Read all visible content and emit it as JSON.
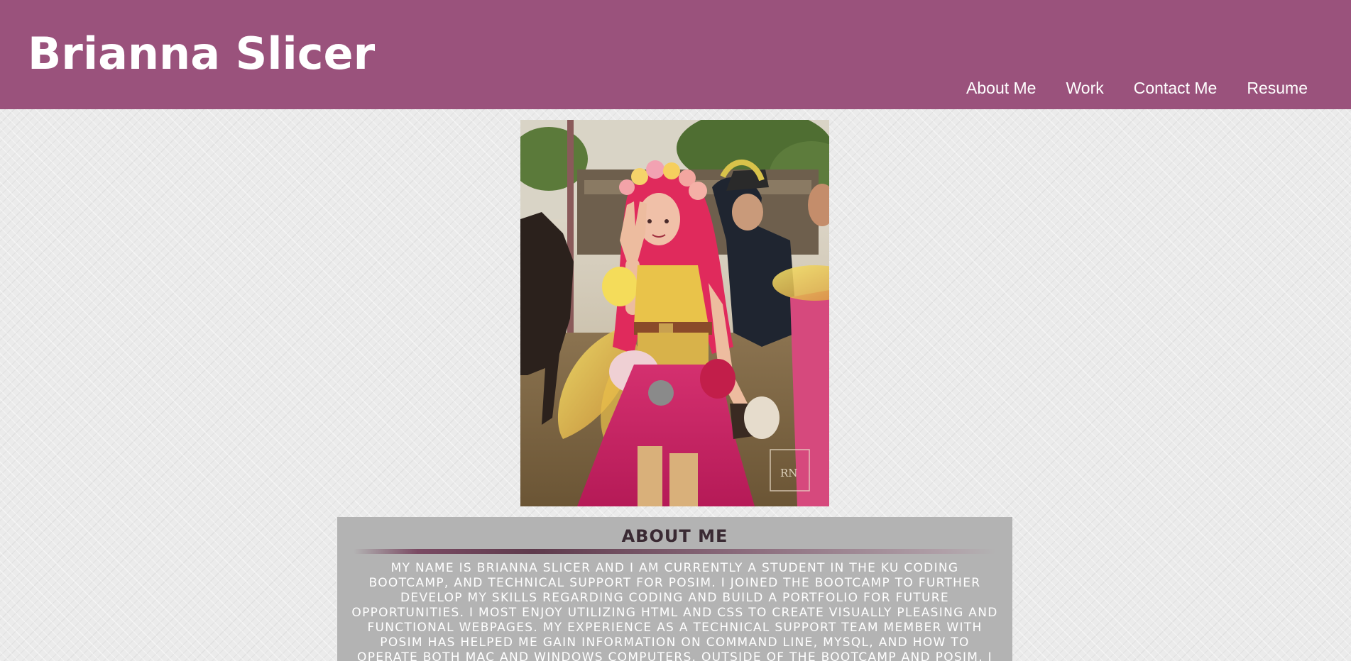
{
  "header": {
    "title": "Brianna Slicer",
    "background_color": "#9a527c",
    "nav": [
      {
        "label": "About Me"
      },
      {
        "label": "Work"
      },
      {
        "label": "Contact Me"
      },
      {
        "label": "Resume"
      }
    ]
  },
  "photo": {
    "alt": "Brianna Slicer in a pink fairy costume at a renaissance festival",
    "watermark": "RN"
  },
  "about": {
    "heading": "ABOUT ME",
    "text": "My name is Brianna Slicer and I am currently a student in the KU Coding Bootcamp, and technical support for POSIM. I joined the bootcamp to further develop my skills regarding coding and build a portfolio for future opportunities. I most enjoy utilizing HTML and CSS to create visually pleasing and functional webpages. My experience as a technical support team member with POSIM has helped me gain information on command line, MySQL, and how to operate both Mac and Windows computers. Outside of the bootcamp and POSIM, I enjoy spending time"
  }
}
